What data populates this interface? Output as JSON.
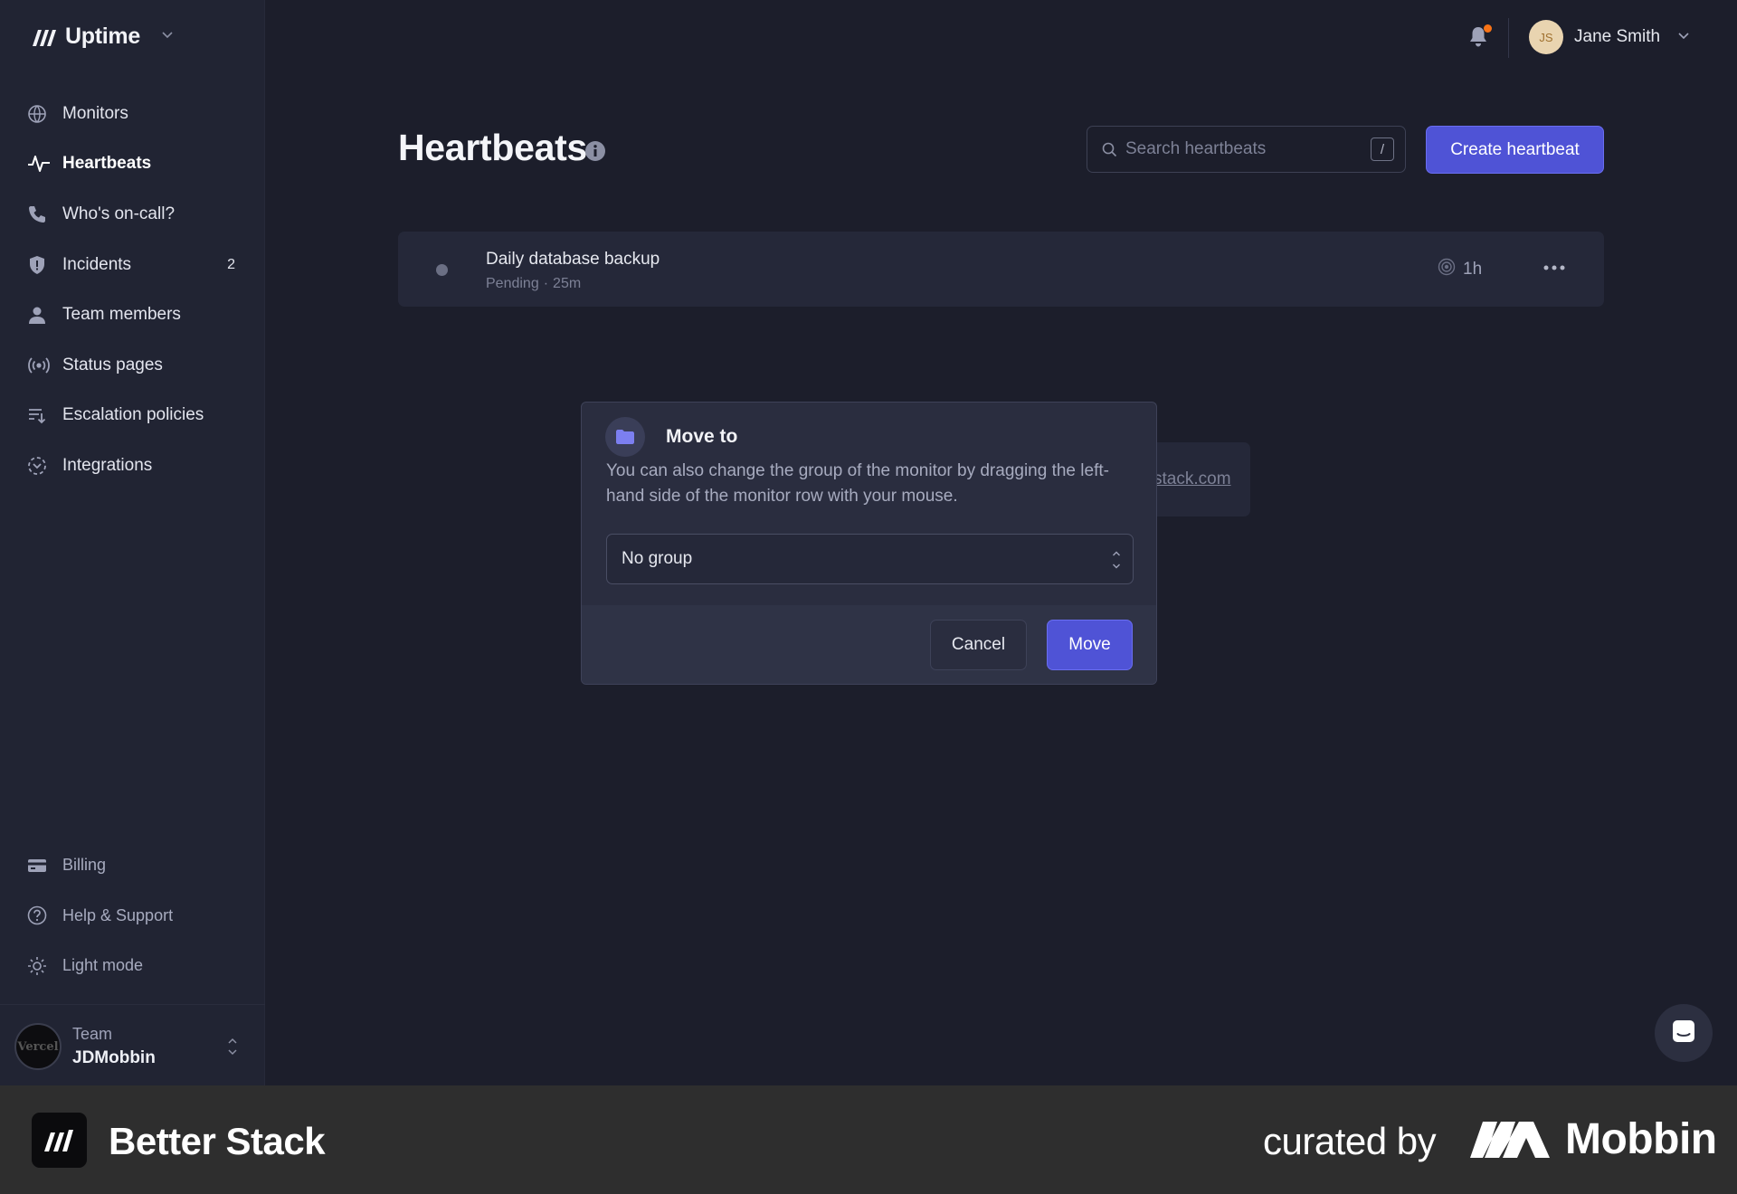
{
  "app": {
    "name": "Uptime"
  },
  "sidebar": {
    "items": [
      {
        "label": "Monitors",
        "icon": "globe-icon"
      },
      {
        "label": "Heartbeats",
        "icon": "pulse-icon",
        "active": true
      },
      {
        "label": "Who's on-call?",
        "icon": "phone-icon"
      },
      {
        "label": "Incidents",
        "icon": "shield-icon",
        "badge": "2"
      },
      {
        "label": "Team members",
        "icon": "user-icon"
      },
      {
        "label": "Status pages",
        "icon": "broadcast-icon"
      },
      {
        "label": "Escalation policies",
        "icon": "escalation-icon"
      },
      {
        "label": "Integrations",
        "icon": "integrations-icon"
      }
    ],
    "bottom_items": [
      {
        "label": "Billing",
        "icon": "credit-card-icon"
      },
      {
        "label": "Help & Support",
        "icon": "help-icon"
      },
      {
        "label": "Light mode",
        "icon": "sun-icon"
      }
    ],
    "team": {
      "label": "Team",
      "name": "JDMobbin",
      "avatar_text": "Vercel"
    }
  },
  "topbar": {
    "user_initials": "JS",
    "user_name": "Jane Smith",
    "notification_dot_color": "#f97316"
  },
  "main": {
    "title": "Heartbeats",
    "search_placeholder": "Search heartbeats",
    "search_shortcut": "/",
    "create_button": "Create heartbeat",
    "heartbeats": [
      {
        "name": "Daily database backup",
        "status": "Pending",
        "age": "25m",
        "period": "1h"
      }
    ],
    "background_link": "stack.com"
  },
  "modal": {
    "title": "Move to",
    "description": "You can also change the group of the monitor by dragging the left-hand side of the monitor row with your mouse.",
    "select_value": "No group",
    "cancel_label": "Cancel",
    "move_label": "Move"
  },
  "banner": {
    "brand": "Better Stack",
    "curated_by": "curated by",
    "curator": "Mobbin"
  },
  "colors": {
    "accent": "#4f53d6",
    "background": "#1c1e2b",
    "sidebar": "#212433"
  }
}
